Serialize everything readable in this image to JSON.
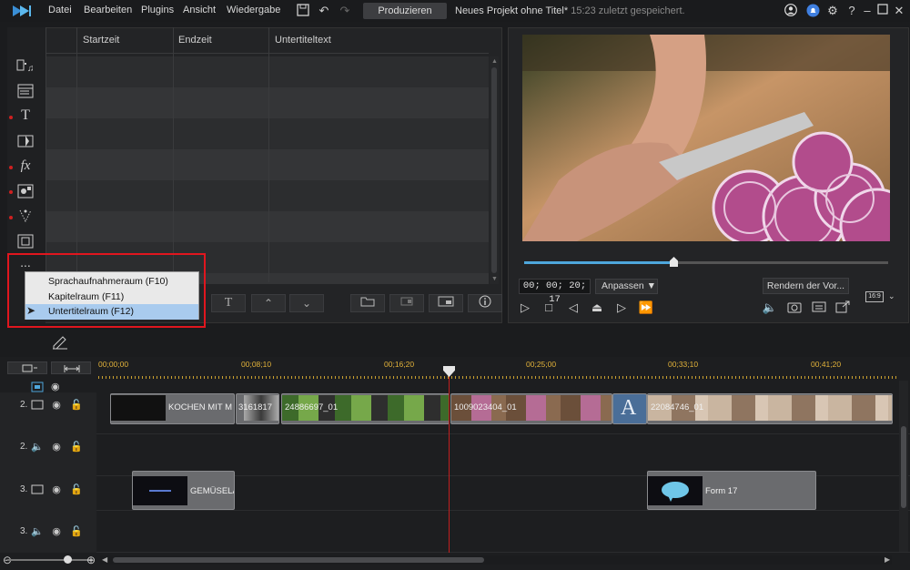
{
  "menu": [
    "Datei",
    "Bearbeiten",
    "Plugins",
    "Ansicht",
    "Wiedergabe"
  ],
  "toolbar": {
    "produce_label": "Produzieren",
    "project_title": "Neues Projekt ohne Titel*",
    "saved_status": "15:23 zuletzt gespeichert."
  },
  "subtitle_table": {
    "columns": [
      "Startzeit",
      "Endzeit",
      "Untertiteltext"
    ]
  },
  "more_menu": {
    "trigger": "...",
    "items": [
      {
        "label": "Sprachaufnahmeraum (F10)",
        "selected": false
      },
      {
        "label": "Kapitelraum (F11)",
        "selected": false
      },
      {
        "label": "Untertitelraum (F12)",
        "selected": true
      }
    ]
  },
  "preview": {
    "timecode": "00; 00; 20; 17",
    "fit_label": "Anpassen",
    "render_label": "Rendern der Vor...",
    "aspect_label": "16:9",
    "progress": 0.41
  },
  "timeline": {
    "ruler_ticks": [
      "00;00;00",
      "00;08;10",
      "00;16;20",
      "00;25;00",
      "00;33;10",
      "00;41;20"
    ],
    "tracks": [
      {
        "number": "2.",
        "type": "video"
      },
      {
        "number": "2.",
        "type": "audio"
      },
      {
        "number": "3.",
        "type": "video"
      },
      {
        "number": "3.",
        "type": "audio"
      }
    ],
    "clips_track2": [
      "KOCHEN MIT M",
      "3161817",
      "24886697_01",
      "1009023404_01",
      "22084746_01"
    ],
    "clips_track3": [
      "GEMÜSELA",
      "Form 17"
    ]
  },
  "colors": {
    "accent": "#4ea7dc",
    "playhead": "#c21f1f",
    "highlight_box": "#e0161e",
    "ruler": "#e2b23a"
  }
}
